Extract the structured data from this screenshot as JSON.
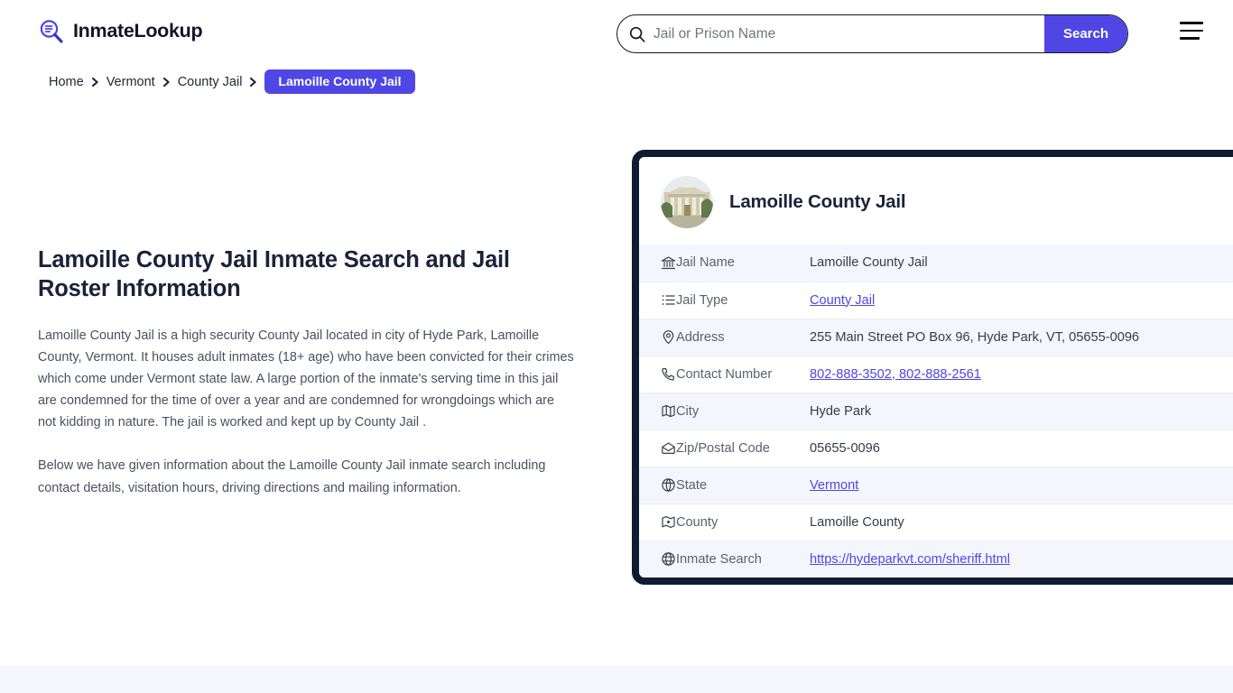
{
  "header": {
    "brand_name": "InmateLookup",
    "brand_icon": "magnifier-list-icon",
    "search": {
      "placeholder": "Jail or Prison Name",
      "value": "",
      "icon": "search-icon",
      "button_label": "Search",
      "accent_color": "#4f46e5"
    },
    "menu_icon": "hamburger-menu-icon"
  },
  "breadcrumb": {
    "items": [
      {
        "label": "Home",
        "current": false
      },
      {
        "label": "Vermont",
        "current": false
      },
      {
        "label": "County Jail",
        "current": false
      },
      {
        "label": "Lamoille County Jail",
        "current": true
      }
    ]
  },
  "main": {
    "title": "Lamoille County Jail Inmate Search and Jail Roster Information",
    "paragraphs": [
      "Lamoille County Jail is a high security County Jail located in city of Hyde Park, Lamoille County, Vermont. It houses adult inmates (18+ age) who have been convicted for their crimes which come under Vermont state law. A large portion of the inmate's serving time in this jail are condemned for the time of over a year and are condemned for wrongdoings which are not kidding in nature. The jail is worked and kept up by County Jail .",
      "Below we have given information about the Lamoille County Jail inmate search including contact details, visitation hours, driving directions and mailing information."
    ]
  },
  "card": {
    "thumbnail_icon": "courthouse-photo",
    "title": "Lamoille County Jail",
    "border_color": "#111a33",
    "rows": [
      {
        "icon": "bank-icon",
        "label": "Jail Name",
        "value": "Lamoille County Jail",
        "link": false
      },
      {
        "icon": "list-icon",
        "label": "Jail Type",
        "value": "County Jail",
        "link": true
      },
      {
        "icon": "map-pin-icon",
        "label": "Address",
        "value": "255 Main Street PO Box 96, Hyde Park, VT, 05655-0096",
        "link": false
      },
      {
        "icon": "phone-icon",
        "label": "Contact Number",
        "value": "802-888-3502, 802-888-2561",
        "link": true
      },
      {
        "icon": "map-icon",
        "label": "City",
        "value": "Hyde Park",
        "link": false
      },
      {
        "icon": "envelope-icon",
        "label": "Zip/Postal Code",
        "value": "05655-0096",
        "link": false
      },
      {
        "icon": "globe-icon",
        "label": "State",
        "value": "Vermont",
        "link": true
      },
      {
        "icon": "map-area-icon",
        "label": "County",
        "value": "Lamoille County",
        "link": false
      },
      {
        "icon": "www-globe-icon",
        "label": "Inmate Search",
        "value": "https://hydeparkvt.com/sheriff.html",
        "link": true
      }
    ]
  }
}
